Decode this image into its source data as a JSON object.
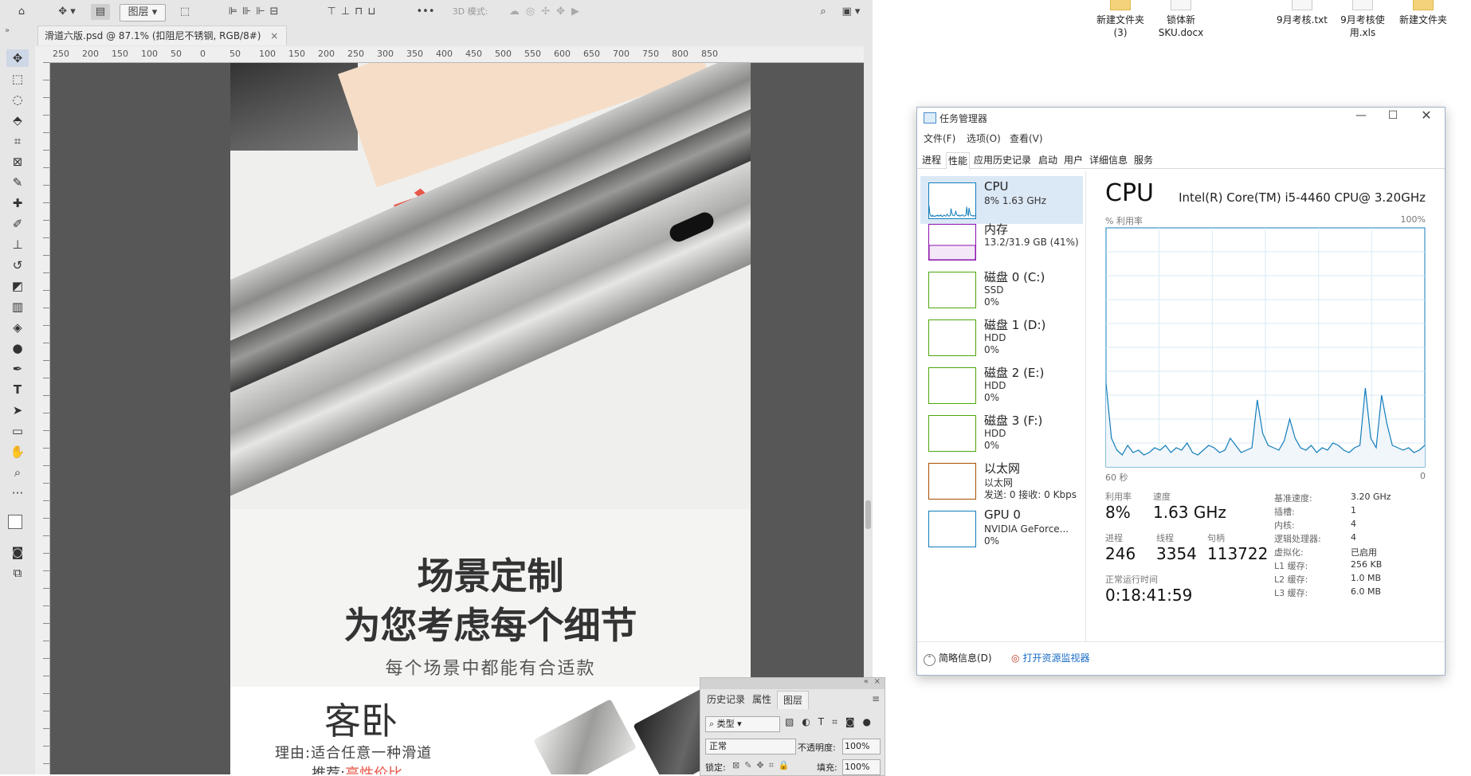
{
  "photoshop": {
    "options_bar": {
      "auto_select_label": "图层",
      "mode_3d_label": "3D 模式:",
      "more_label": "•••"
    },
    "document_tab": {
      "title": "滑道六版.psd @ 87.1% (扣阻尼不锈钢, RGB/8#)",
      "close": "×"
    },
    "ruler_ticks": [
      "250",
      "200",
      "150",
      "100",
      "50",
      "0",
      "50",
      "100",
      "150",
      "200",
      "250",
      "300",
      "350",
      "400",
      "450",
      "500",
      "550",
      "600",
      "650",
      "700",
      "750",
      "800",
      "850"
    ],
    "artwork": {
      "product_size_tag": "宽4.5cm",
      "section_title_line1": "场景定制",
      "section_title_line2": "为您考虑每个细节",
      "section_subtitle": "每个场景中都能有合适款",
      "room_title": "客卧",
      "reason_text": "理由:适合任意一种滑道",
      "recommend_prefix": "推荐:",
      "recommend_highlight": "高性价比"
    },
    "layers_panel": {
      "tabs": [
        "历史记录",
        "属性",
        "图层"
      ],
      "filter_label": "类型",
      "blend_mode": "正常",
      "opacity_label": "不透明度:",
      "opacity_value": "100%",
      "lock_label": "锁定:",
      "fill_label": "填充:",
      "fill_value": "100%"
    }
  },
  "desktop": {
    "icons": [
      {
        "label": "新建文件夹 (3)",
        "type": "folder"
      },
      {
        "label": "锁体新 SKU.docx",
        "type": "file"
      },
      {
        "label": "9月考核.txt",
        "type": "file"
      },
      {
        "label": "9月考核使用.xls",
        "type": "file"
      },
      {
        "label": "新建文件夹",
        "type": "folder"
      }
    ]
  },
  "task_manager": {
    "title": "任务管理器",
    "menu": [
      "文件(F)",
      "选项(O)",
      "查看(V)"
    ],
    "tabs": [
      "进程",
      "性能",
      "应用历史记录",
      "启动",
      "用户",
      "详细信息",
      "服务"
    ],
    "active_tab": "性能",
    "sidebar": [
      {
        "name": "CPU",
        "line1": "8% 1.63 GHz",
        "line2": "",
        "color": "#117dbb"
      },
      {
        "name": "内存",
        "line1": "13.2/31.9 GB (41%)",
        "line2": "",
        "color": "#8b12ae"
      },
      {
        "name": "磁盘 0 (C:)",
        "line1": "SSD",
        "line2": "0%",
        "color": "#4da60c"
      },
      {
        "name": "磁盘 1 (D:)",
        "line1": "HDD",
        "line2": "0%",
        "color": "#4da60c"
      },
      {
        "name": "磁盘 2 (E:)",
        "line1": "HDD",
        "line2": "0%",
        "color": "#4da60c"
      },
      {
        "name": "磁盘 3 (F:)",
        "line1": "HDD",
        "line2": "0%",
        "color": "#4da60c"
      },
      {
        "name": "以太网",
        "line1": "以太网",
        "line2": "发送: 0 接收: 0 Kbps",
        "color": "#a74f01"
      },
      {
        "name": "GPU 0",
        "line1": "NVIDIA GeForce...",
        "line2": "0%",
        "color": "#117dbb"
      }
    ],
    "detail": {
      "heading": "CPU",
      "model": "Intel(R) Core(TM) i5-4460 CPU@ 3.20GHz",
      "y_label": "% 利用率",
      "y_max": "100%",
      "x_left": "60 秒",
      "x_right": "0",
      "utilization_label": "利用率",
      "utilization": "8%",
      "speed_label": "速度",
      "speed": "1.63 GHz",
      "processes_label": "进程",
      "processes": "246",
      "threads_label": "线程",
      "threads": "3354",
      "handles_label": "句柄",
      "handles": "113722",
      "uptime_label": "正常运行时间",
      "uptime": "0:18:41:59",
      "specs": [
        {
          "k": "基准速度:",
          "v": "3.20 GHz"
        },
        {
          "k": "插槽:",
          "v": "1"
        },
        {
          "k": "内核:",
          "v": "4"
        },
        {
          "k": "逻辑处理器:",
          "v": "4"
        },
        {
          "k": "虚拟化:",
          "v": "已启用"
        },
        {
          "k": "L1 缓存:",
          "v": "256 KB"
        },
        {
          "k": "L2 缓存:",
          "v": "1.0 MB"
        },
        {
          "k": "L3 缓存:",
          "v": "6.0 MB"
        }
      ]
    },
    "footer": {
      "fewer_details": "简略信息(D)",
      "resource_monitor": "打开资源监视器"
    }
  },
  "chart_data": {
    "type": "area",
    "title": "CPU",
    "ylabel": "% 利用率",
    "ylim": [
      0,
      100
    ],
    "x_range_seconds": [
      60,
      0
    ],
    "grid": true,
    "series": [
      {
        "values": [
          35,
          12,
          7,
          5,
          9,
          6,
          7,
          5,
          6,
          8,
          7,
          9,
          6,
          8,
          7,
          10,
          6,
          5,
          7,
          9,
          8,
          6,
          7,
          12,
          9,
          6,
          7,
          8,
          28,
          14,
          9,
          8,
          7,
          11,
          20,
          12,
          8,
          7,
          9,
          6,
          8,
          7,
          10,
          9,
          7,
          6,
          8,
          9,
          33,
          12,
          8,
          30,
          18,
          9,
          8,
          7,
          8,
          6,
          7,
          9
        ]
      }
    ]
  }
}
